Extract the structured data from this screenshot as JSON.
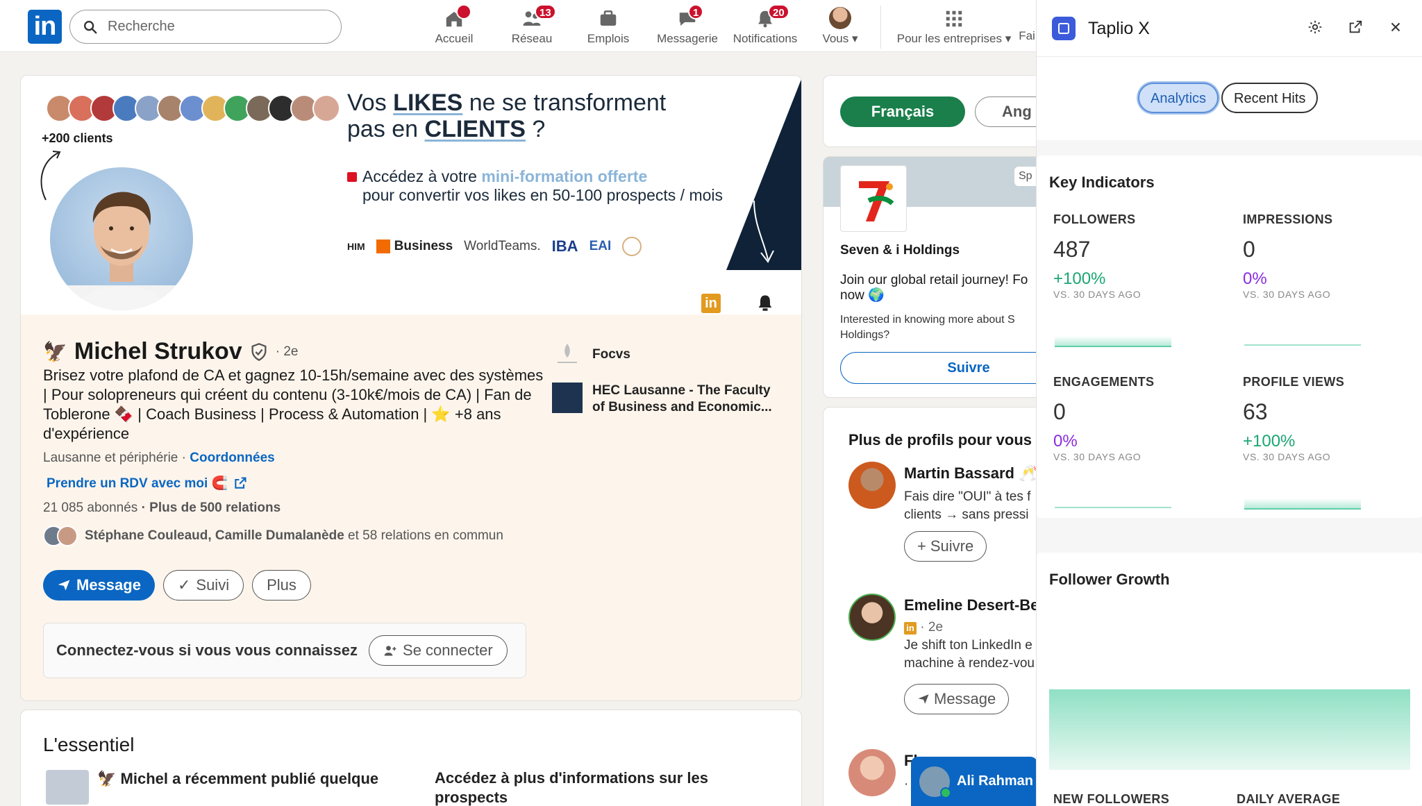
{
  "nav": {
    "search_placeholder": "Recherche",
    "items": [
      {
        "label": "Accueil",
        "badge": ""
      },
      {
        "label": "Réseau",
        "badge": "13"
      },
      {
        "label": "Emplois",
        "badge": ""
      },
      {
        "label": "Messagerie",
        "badge": "1"
      },
      {
        "label": "Notifications",
        "badge": "20"
      },
      {
        "label": "Vous",
        "badge": ""
      },
      {
        "label": "Pour les entreprises",
        "badge": ""
      },
      {
        "label": "Fai",
        "badge": ""
      }
    ]
  },
  "banner": {
    "clients": "+200 clients",
    "headline_a": "Vos ",
    "headline_b": "LIKES",
    "headline_c": " ne se transforment",
    "headline_d": "pas en ",
    "headline_e": "CLIENTS",
    "headline_f": " ?",
    "offer_a": "Accédez à votre ",
    "offer_b": "mini-formation offerte",
    "offer_c": "pour convertir vos likes en 50-100 prospects / mois",
    "logos": [
      "HIM",
      "Business",
      "WorldTeams.",
      "IBA",
      "EAI"
    ]
  },
  "profile": {
    "name": "Michel Strukov",
    "degree": "· 2e",
    "bio": "Brisez votre plafond de CA et gagnez 10-15h/semaine avec des systèmes | Pour solopreneurs qui créent du contenu (3-10k€/mois de CA) | Fan de Toblerone 🍫 | Coach Business | Process & Automation | ⭐ +8 ans d'expérience",
    "location": "Lausanne et périphérie · ",
    "contact": "Coordonnées",
    "rdv": "Prendre un RDV avec moi 🧲",
    "followers": "21 085 abonnés",
    "relations": " · Plus de 500 relations",
    "common_names": "Stéphane Couleaud, Camille Dumalanède",
    "common_rest": " et 58 relations en commun",
    "btn_message": "Message",
    "btn_follow": "Suivi",
    "btn_more": "Plus",
    "connect_text": "Connectez-vous si vous vous connaissez",
    "btn_connect": "Se connecter",
    "org1": "Focvs",
    "org2": "HEC Lausanne - The Faculty of Business and Economic..."
  },
  "essentials": {
    "title": "L'essentiel",
    "post": "Michel a récemment publié quelque",
    "prospects": "Accédez à plus d'informations sur les prospects"
  },
  "lang": {
    "active": "Français",
    "other": "Ang"
  },
  "ad": {
    "badge": "Sp",
    "company": "Seven & i Holdings",
    "text1": "Join our global retail journey! Fo",
    "text1b": "now 🌍",
    "text2": "Interested in knowing more about S",
    "text2b": "Holdings?",
    "follow": "Suivre"
  },
  "more_profiles": {
    "title": "Plus de profils pour vous",
    "people": [
      {
        "name": "Martin Bassard 🥂",
        "desc1": "Fais dire \"OUI\" à tes f",
        "desc2": "clients → sans pressi",
        "button": "Suivre"
      },
      {
        "name": "Emeline Desert-Be",
        "desc0": "· 2e",
        "desc1": "Je shift ton LinkedIn e",
        "desc2": "machine à rendez-vou",
        "button": "Message"
      },
      {
        "name": "Fl",
        "desc1": "·",
        "desc2": ""
      }
    ]
  },
  "chat": {
    "name": "Ali Rahman"
  },
  "taplio": {
    "title": "Taplio X",
    "tabs": [
      "Analytics",
      "Recent Hits"
    ],
    "key_title": "Key Indicators",
    "metrics": [
      {
        "label": "FOLLOWERS",
        "value": "487",
        "change": "+100%",
        "since": "VS. 30 DAYS AGO"
      },
      {
        "label": "IMPRESSIONS",
        "value": "0",
        "change": "0%",
        "since": "VS. 30 DAYS AGO"
      },
      {
        "label": "ENGAGEMENTS",
        "value": "0",
        "change": "0%",
        "since": "VS. 30 DAYS AGO"
      },
      {
        "label": "PROFILE VIEWS",
        "value": "63",
        "change": "+100%",
        "since": "VS. 30 DAYS AGO"
      }
    ],
    "growth_title": "Follower Growth",
    "footer_left": "NEW FOLLOWERS",
    "footer_right": "DAILY AVERAGE"
  },
  "colors": {
    "linkedin_blue": "#0a66c2",
    "green": "#1a7f4b",
    "taplio_green": "#1aa673",
    "taplio_purple": "#8a2be2"
  }
}
